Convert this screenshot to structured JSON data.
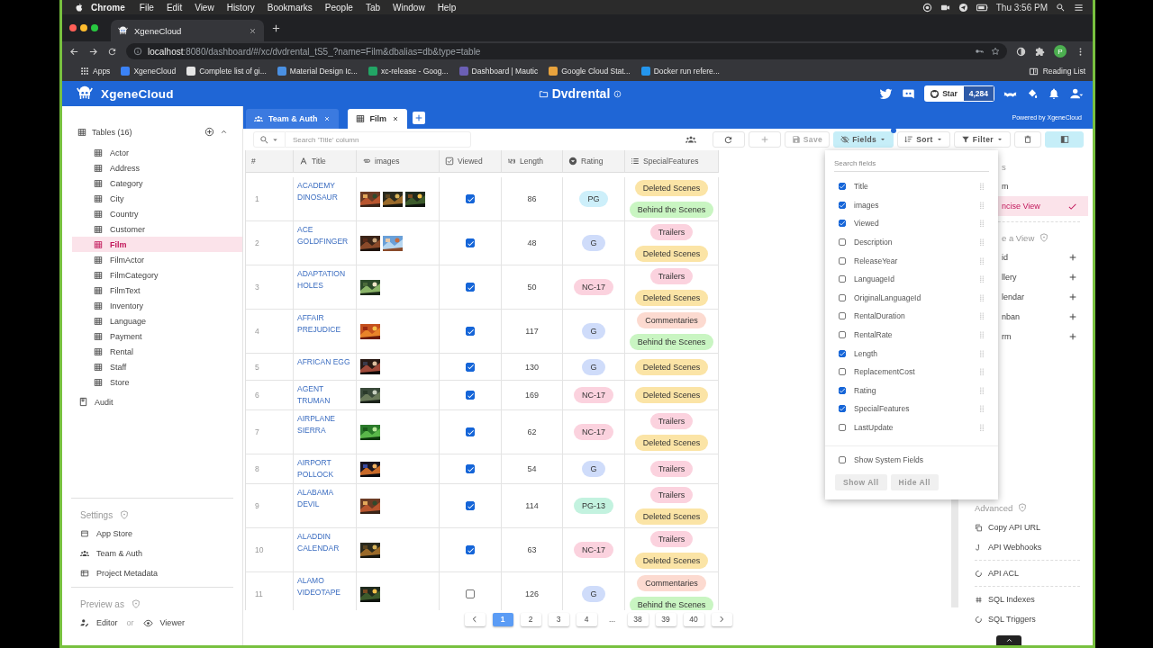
{
  "menubar": {
    "app": "Chrome",
    "menus": [
      "File",
      "Edit",
      "View",
      "History",
      "Bookmarks",
      "People",
      "Tab",
      "Window",
      "Help"
    ],
    "clock": "Thu 3:56 PM"
  },
  "browser": {
    "tab_title": "XgeneCloud",
    "url_host": "localhost",
    "url_rest": ":8080/dashboard/#/xc/dvdrental_tS5_?name=Film&dbalias=db&type=table",
    "profile": "P",
    "bookmarks": [
      {
        "label": "Apps",
        "kind": "apps"
      },
      {
        "label": "XgeneCloud",
        "kind": "site",
        "color": "#3b82f6"
      },
      {
        "label": "Complete list of gi...",
        "kind": "site",
        "color": "#e5e5e5"
      },
      {
        "label": "Material Design Ic...",
        "kind": "site",
        "color": "#4a90e2"
      },
      {
        "label": "xc-release - Goog...",
        "kind": "site",
        "color": "#22a565"
      },
      {
        "label": "Dashboard | Mautic",
        "kind": "site",
        "color": "#6b5fb5"
      },
      {
        "label": "Google Cloud Stat...",
        "kind": "site",
        "color": "#e8a33d"
      },
      {
        "label": "Docker run refere...",
        "kind": "site",
        "color": "#2496ed"
      }
    ],
    "reading_list": "Reading List"
  },
  "header": {
    "brand": "XgeneCloud",
    "project": "Dvdrental",
    "star_label": "Star",
    "star_count": "4,284"
  },
  "tabs": [
    {
      "label": "Team & Auth",
      "selected": false
    },
    {
      "label": "Film",
      "selected": true
    }
  ],
  "powered_by": "Powered by XgeneCloud",
  "sidebar": {
    "heading": "Tables (16)",
    "tables": [
      {
        "label": "Actor",
        "selected": false
      },
      {
        "label": "Address",
        "selected": false
      },
      {
        "label": "Category",
        "selected": false
      },
      {
        "label": "City",
        "selected": false
      },
      {
        "label": "Country",
        "selected": false
      },
      {
        "label": "Customer",
        "selected": false
      },
      {
        "label": "Film",
        "selected": true
      },
      {
        "label": "FilmActor",
        "selected": false
      },
      {
        "label": "FilmCategory",
        "selected": false
      },
      {
        "label": "FilmText",
        "selected": false
      },
      {
        "label": "Inventory",
        "selected": false
      },
      {
        "label": "Language",
        "selected": false
      },
      {
        "label": "Payment",
        "selected": false
      },
      {
        "label": "Rental",
        "selected": false
      },
      {
        "label": "Staff",
        "selected": false
      },
      {
        "label": "Store",
        "selected": false
      }
    ],
    "audit": "Audit",
    "settings_heading": "Settings",
    "settings_items": [
      "App Store",
      "Team & Auth",
      "Project Metadata"
    ],
    "preview_heading": "Preview as",
    "preview_editor": "Editor",
    "preview_or": "or",
    "preview_viewer": "Viewer"
  },
  "toolbar": {
    "search_placeholder": "Search 'Title' column",
    "save": "Save",
    "fields": "Fields",
    "sort": "Sort",
    "filter": "Filter"
  },
  "table": {
    "columns": [
      {
        "label": "#",
        "kind": "index"
      },
      {
        "label": "Title",
        "kind": "text"
      },
      {
        "label": "images",
        "kind": "attachment"
      },
      {
        "label": "Viewed",
        "kind": "checkbox"
      },
      {
        "label": "Length",
        "kind": "number"
      },
      {
        "label": "Rating",
        "kind": "single_select"
      },
      {
        "label": "SpecialFeatures",
        "kind": "multi_select"
      }
    ],
    "rows": [
      {
        "index": "1",
        "title": "ACADEMY DINOSAUR",
        "images": [
          {
            "kind": "picture"
          },
          {
            "kind": "picture"
          },
          {
            "kind": "picture"
          }
        ],
        "viewed": true,
        "length": "86",
        "rating": {
          "label": "PG",
          "color": "#cdeffa"
        },
        "features": [
          {
            "label": "Deleted Scenes",
            "color": "#fbe4a6"
          },
          {
            "label": "Behind the Scenes",
            "color": "#c9f5c2"
          }
        ]
      },
      {
        "index": "2",
        "title": "ACE GOLDFINGER",
        "images": [
          {
            "kind": "picture"
          },
          {
            "kind": "picture"
          }
        ],
        "viewed": true,
        "length": "48",
        "rating": {
          "label": "G",
          "color": "#cfdcfa"
        },
        "features": [
          {
            "label": "Trailers",
            "color": "#fbd2de"
          },
          {
            "label": "Deleted Scenes",
            "color": "#fbe4a6"
          }
        ]
      },
      {
        "index": "3",
        "title": "ADAPTATION HOLES",
        "images": [
          {
            "kind": "picture"
          }
        ],
        "viewed": true,
        "length": "50",
        "rating": {
          "label": "NC-17",
          "color": "#fbd2de"
        },
        "features": [
          {
            "label": "Trailers",
            "color": "#fbd2de"
          },
          {
            "label": "Deleted Scenes",
            "color": "#fbe4a6"
          }
        ]
      },
      {
        "index": "4",
        "title": "AFFAIR PREJUDICE",
        "images": [
          {
            "kind": "picture"
          }
        ],
        "viewed": true,
        "length": "117",
        "rating": {
          "label": "G",
          "color": "#cfdcfa"
        },
        "features": [
          {
            "label": "Commentaries",
            "color": "#fcdad0"
          },
          {
            "label": "Behind the Scenes",
            "color": "#c9f5c2"
          }
        ]
      },
      {
        "index": "5",
        "title": "AFRICAN EGG",
        "images": [
          {
            "kind": "picture"
          }
        ],
        "viewed": true,
        "length": "130",
        "rating": {
          "label": "G",
          "color": "#cfdcfa"
        },
        "features": [
          {
            "label": "Deleted Scenes",
            "color": "#fbe4a6"
          }
        ]
      },
      {
        "index": "6",
        "title": "AGENT TRUMAN",
        "images": [
          {
            "kind": "picture"
          }
        ],
        "viewed": true,
        "length": "169",
        "rating": {
          "label": "NC-17",
          "color": "#fbd2de"
        },
        "features": [
          {
            "label": "Deleted Scenes",
            "color": "#fbe4a6"
          }
        ]
      },
      {
        "index": "7",
        "title": "AIRPLANE SIERRA",
        "images": [
          {
            "kind": "picture"
          }
        ],
        "viewed": true,
        "length": "62",
        "rating": {
          "label": "NC-17",
          "color": "#fbd2de"
        },
        "features": [
          {
            "label": "Trailers",
            "color": "#fbd2de"
          },
          {
            "label": "Deleted Scenes",
            "color": "#fbe4a6"
          }
        ]
      },
      {
        "index": "8",
        "title": "AIRPORT POLLOCK",
        "images": [
          {
            "kind": "picture"
          }
        ],
        "viewed": true,
        "length": "54",
        "rating": {
          "label": "G",
          "color": "#cfdcfa"
        },
        "features": [
          {
            "label": "Trailers",
            "color": "#fbd2de"
          }
        ]
      },
      {
        "index": "9",
        "title": "ALABAMA DEVIL",
        "images": [
          {
            "kind": "picture"
          }
        ],
        "viewed": true,
        "length": "114",
        "rating": {
          "label": "PG-13",
          "color": "#c3f2df"
        },
        "features": [
          {
            "label": "Trailers",
            "color": "#fbd2de"
          },
          {
            "label": "Deleted Scenes",
            "color": "#fbe4a6"
          }
        ]
      },
      {
        "index": "10",
        "title": "ALADDIN CALENDAR",
        "images": [
          {
            "kind": "picture"
          }
        ],
        "viewed": true,
        "length": "63",
        "rating": {
          "label": "NC-17",
          "color": "#fbd2de"
        },
        "features": [
          {
            "label": "Trailers",
            "color": "#fbd2de"
          },
          {
            "label": "Deleted Scenes",
            "color": "#fbe4a6"
          }
        ]
      },
      {
        "index": "11",
        "title": "ALAMO VIDEOTAPE",
        "images": [
          {
            "kind": "picture"
          }
        ],
        "viewed": false,
        "length": "126",
        "rating": {
          "label": "G",
          "color": "#cfdcfa"
        },
        "features": [
          {
            "label": "Commentaries",
            "color": "#fcdad0"
          },
          {
            "label": "Behind the Scenes",
            "color": "#c9f5c2"
          }
        ]
      }
    ]
  },
  "pagination": {
    "pages": [
      {
        "label": "1",
        "kind": "page",
        "selected": true
      },
      {
        "label": "2",
        "kind": "page",
        "selected": false
      },
      {
        "label": "3",
        "kind": "page",
        "selected": false
      },
      {
        "label": "4",
        "kind": "page",
        "selected": false
      },
      {
        "label": "...",
        "kind": "ellipsis"
      },
      {
        "label": "38",
        "kind": "page",
        "selected": false
      },
      {
        "label": "39",
        "kind": "page",
        "selected": false
      },
      {
        "label": "40",
        "kind": "page",
        "selected": false
      }
    ]
  },
  "fields_menu": {
    "search_placeholder": "Search fields",
    "fields": [
      {
        "label": "Title",
        "checked": true
      },
      {
        "label": "images",
        "checked": true
      },
      {
        "label": "Viewed",
        "checked": true
      },
      {
        "label": "Description",
        "checked": false
      },
      {
        "label": "ReleaseYear",
        "checked": false
      },
      {
        "label": "LanguageId",
        "checked": false
      },
      {
        "label": "OriginalLanguageId",
        "checked": false
      },
      {
        "label": "RentalDuration",
        "checked": false
      },
      {
        "label": "RentalRate",
        "checked": false
      },
      {
        "label": "Length",
        "checked": true
      },
      {
        "label": "ReplacementCost",
        "checked": false
      },
      {
        "label": "Rating",
        "checked": true
      },
      {
        "label": "SpecialFeatures",
        "checked": true
      },
      {
        "label": "LastUpdate",
        "checked": false
      }
    ],
    "system_fields": {
      "label": "Show System Fields",
      "checked": false
    },
    "show_all": "Show All",
    "hide_all": "Hide All"
  },
  "right_panel": {
    "views_heading": "s",
    "views": [
      {
        "label": "m",
        "selected": false
      },
      {
        "label": "ncise View",
        "selected": true
      }
    ],
    "create_heading": "e a View",
    "create_items": [
      "id",
      "llery",
      "lendar",
      "nban",
      "rm"
    ],
    "advanced_heading": "Advanced",
    "advanced_items": [
      "Copy API URL",
      "API Webhooks",
      "API ACL",
      "SQL Indexes",
      "SQL Triggers"
    ]
  }
}
